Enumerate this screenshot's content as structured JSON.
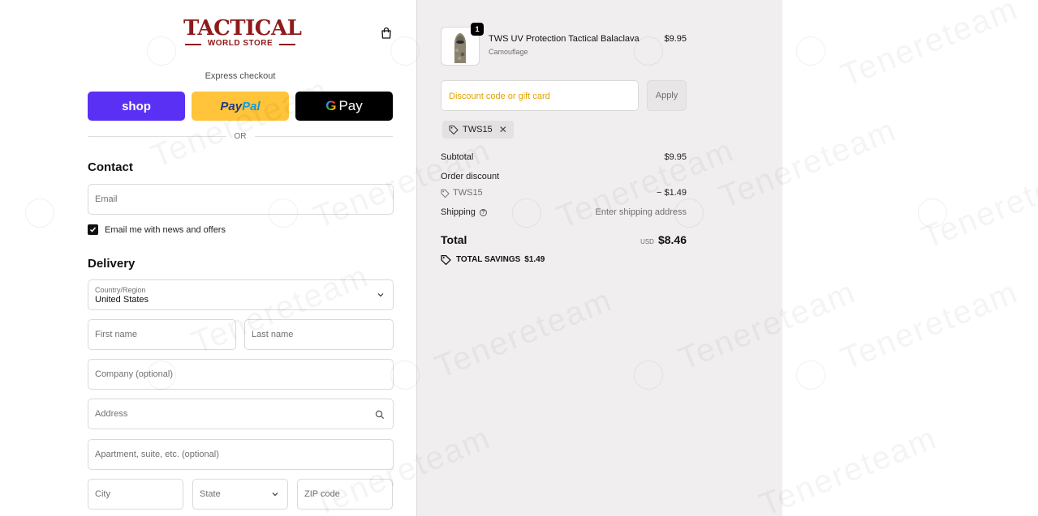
{
  "store": {
    "logo_main": "TACTICAL",
    "logo_sub": "WORLD STORE",
    "brand_color": "#8f1a1a",
    "cart_icon": "shopping-bag-icon"
  },
  "express": {
    "label": "Express checkout",
    "shop": "shop",
    "paypal_a": "Pay",
    "paypal_b": "Pal",
    "gpay_g": "G",
    "gpay_text": "Pay",
    "or": "OR"
  },
  "contact": {
    "title": "Contact",
    "email_placeholder": "Email",
    "newsletter_label": "Email me with news and offers",
    "newsletter_checked": true
  },
  "delivery": {
    "title": "Delivery",
    "country_label": "Country/Region",
    "country_value": "United States",
    "first_name": "First name",
    "last_name": "Last name",
    "company": "Company (optional)",
    "address": "Address",
    "apartment": "Apartment, suite, etc. (optional)",
    "city": "City",
    "state": "State",
    "zip": "ZIP code"
  },
  "summary": {
    "product": {
      "name": "TWS UV Protection Tactical Balaclava",
      "variant": "Camouflage",
      "price": "$9.95",
      "quantity": "1"
    },
    "discount_placeholder": "Discount code or gift card",
    "apply": "Apply",
    "applied_code": "TWS15",
    "subtotal_label": "Subtotal",
    "subtotal_value": "$9.95",
    "order_discount_label": "Order discount",
    "discount_code": "TWS15",
    "discount_value": "− $1.49",
    "shipping_label": "Shipping",
    "shipping_value": "Enter shipping address",
    "total_label": "Total",
    "currency": "USD",
    "total_value": "$8.46",
    "savings_label": "TOTAL SAVINGS",
    "savings_value": "$1.49"
  },
  "watermark": {
    "text": "Tenereteam"
  }
}
